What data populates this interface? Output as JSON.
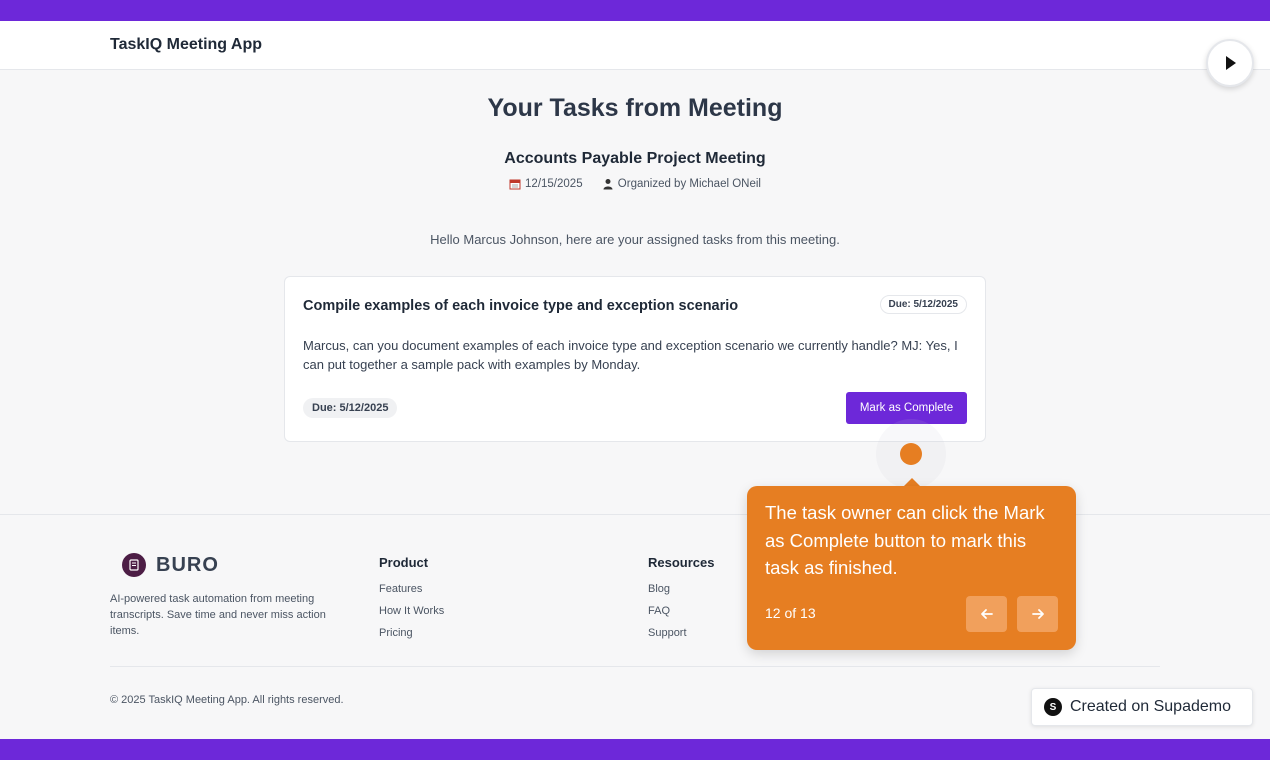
{
  "header": {
    "app_name": "TaskIQ Meeting App"
  },
  "main": {
    "title": "Your Tasks from Meeting",
    "meeting_title": "Accounts Payable Project Meeting",
    "meeting_date": "12/15/2025",
    "organizer": "Organized by Michael ONeil",
    "greeting": "Hello Marcus Johnson, here are your assigned tasks from this meeting."
  },
  "task": {
    "title": "Compile examples of each invoice type and exception scenario",
    "due_top": "Due: 5/12/2025",
    "description": "Marcus, can you document examples of each invoice type and exception scenario we currently handle? MJ: Yes, I can put together a sample pack with examples by Monday.",
    "due_bottom": "Due: 5/12/2025",
    "complete_label": "Mark as Complete"
  },
  "footer": {
    "brand": "BURO",
    "description": "AI-powered task automation from meeting transcripts. Save time and never miss action items.",
    "product": {
      "heading": "Product",
      "links": [
        "Features",
        "How It Works",
        "Pricing"
      ]
    },
    "resources": {
      "heading": "Resources",
      "links": [
        "Blog",
        "FAQ",
        "Support"
      ]
    },
    "copyright": "© 2025 TaskIQ Meeting App. All rights reserved."
  },
  "tooltip": {
    "text": "The task owner can click the Mark as Complete button to mark this task as finished.",
    "step": "12 of 13"
  },
  "badge": {
    "text": "Created on Supademo",
    "icon_letter": "S"
  },
  "colors": {
    "accent": "#6d28d9",
    "tooltip": "#e67e22"
  },
  "icons": [
    "play-icon",
    "calendar-icon",
    "user-icon",
    "arrow-left-icon",
    "arrow-right-icon",
    "buro-logo-icon"
  ]
}
